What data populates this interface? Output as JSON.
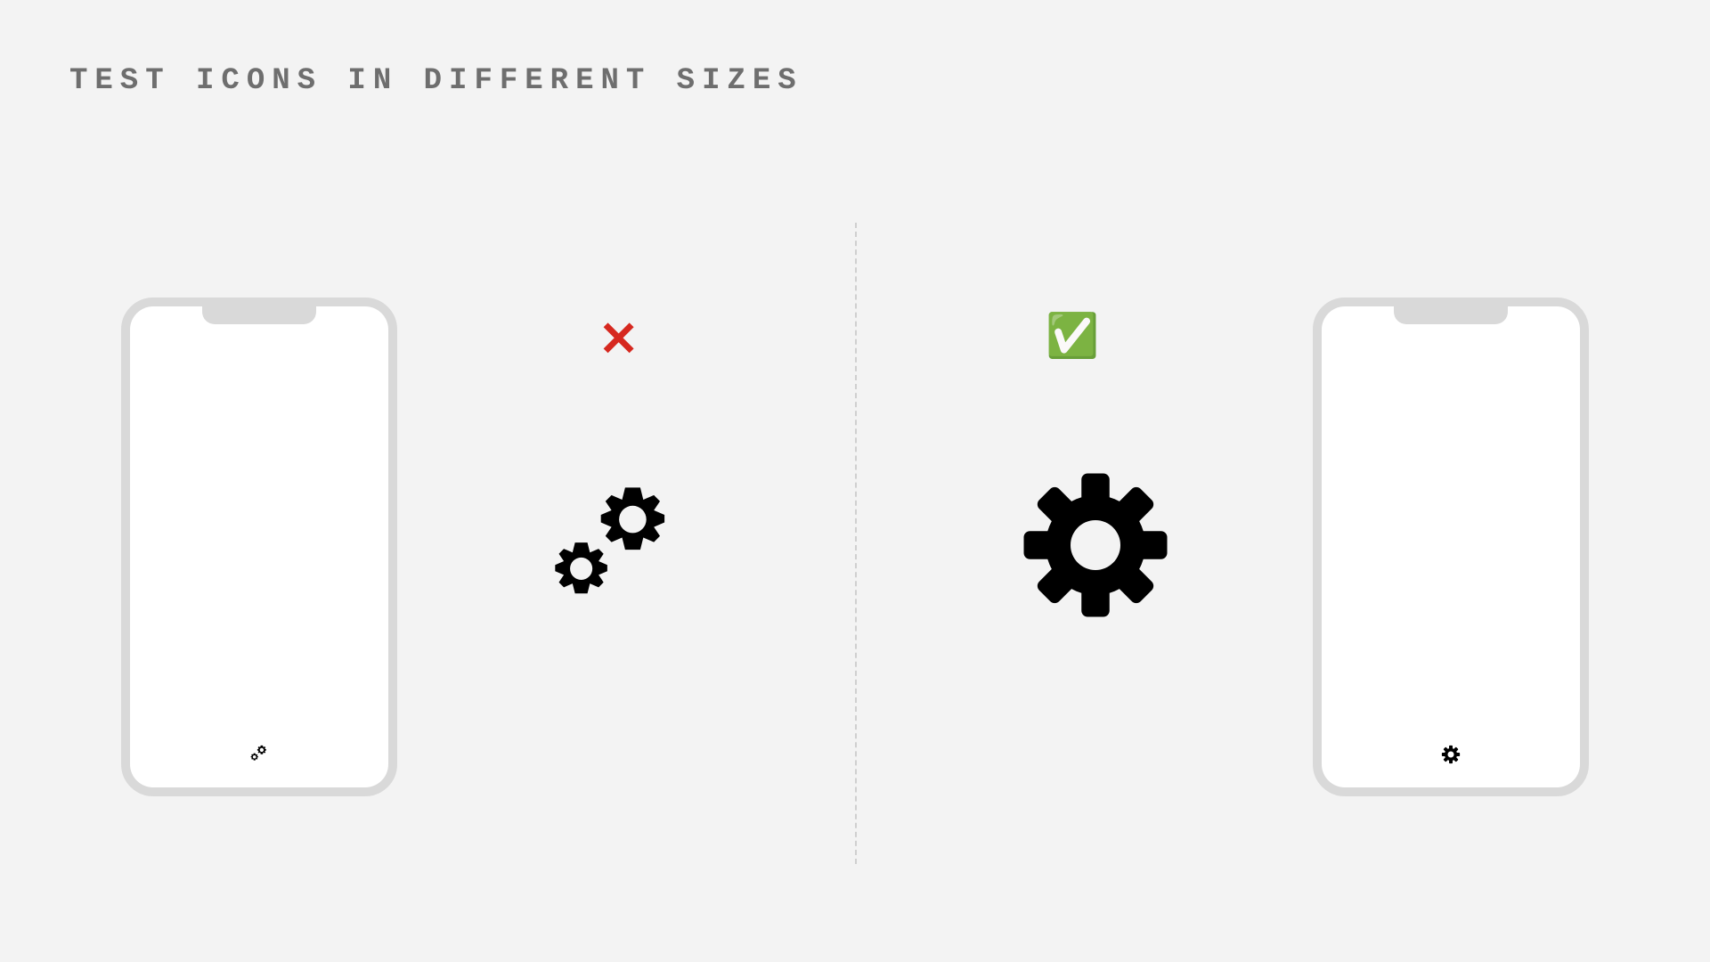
{
  "title": "TEST ICONS IN DIFFERENT SIZES",
  "left": {
    "status": "bad",
    "status_symbol": "✕",
    "icon_name": "double-gear-icon"
  },
  "right": {
    "status": "good",
    "status_symbol": "✅",
    "icon_name": "single-gear-icon"
  },
  "colors": {
    "bg": "#f3f3f3",
    "phone_frame": "#d9d9d9",
    "title_text": "#6e6e6e",
    "cross": "#d6281f",
    "check": "#1faa00"
  }
}
